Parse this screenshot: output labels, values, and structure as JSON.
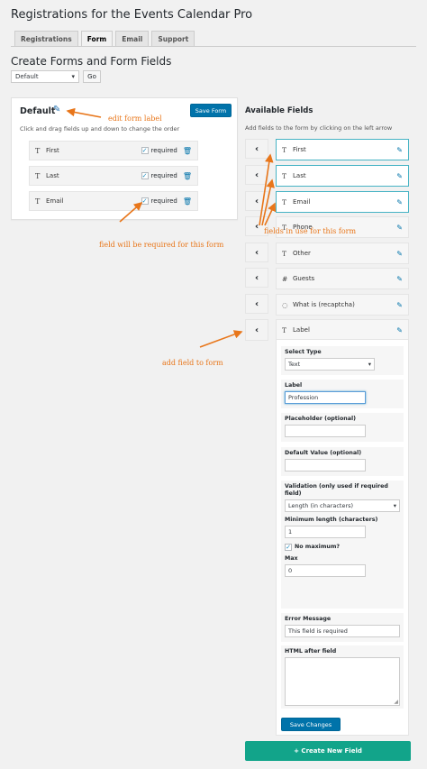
{
  "page_title": "Registrations for the Events Calendar Pro",
  "tabs": [
    "Registrations",
    "Form",
    "Email",
    "Support"
  ],
  "section_title": "Create Forms and Form Fields",
  "form_select": {
    "value": "Default",
    "go_label": "Go"
  },
  "form_box": {
    "label": "Default",
    "save_label": "Save Form",
    "hint": "Click and drag fields up and down to change the order",
    "fields": [
      {
        "name": "First",
        "required_label": "required"
      },
      {
        "name": "Last",
        "required_label": "required"
      },
      {
        "name": "Email",
        "required_label": "required"
      }
    ]
  },
  "available": {
    "title": "Available Fields",
    "hint": "Add fields to the form by clicking on the left arrow",
    "fields": [
      {
        "name": "First",
        "icon": "T"
      },
      {
        "name": "Last",
        "icon": "T"
      },
      {
        "name": "Email",
        "icon": "T"
      },
      {
        "name": "Phone",
        "icon": "T"
      },
      {
        "name": "Other",
        "icon": "T"
      },
      {
        "name": "Guests",
        "icon": "#"
      },
      {
        "name": "What is (recaptcha)",
        "icon": "◌"
      },
      {
        "name": "Label",
        "icon": "T"
      }
    ]
  },
  "settings": {
    "select_type_label": "Select Type",
    "select_type_value": "Text",
    "label_label": "Label",
    "label_value": "Profession",
    "placeholder_label": "Placeholder (optional)",
    "default_label": "Default Value (optional)",
    "validation_label": "Validation (only used if required field)",
    "validation_value": "Length (in characters)",
    "min_label": "Minimum length (characters)",
    "min_value": "1",
    "no_max_label": "No maximum?",
    "max_label": "Max",
    "max_value": "0",
    "error_label": "Error Message",
    "error_value": "This field is required",
    "html_after_label": "HTML after field",
    "save_changes": "Save Changes"
  },
  "create_new_field": "+ Create New Field",
  "annotations": {
    "edit_label": "edit form label",
    "in_use": "fields in use for this form",
    "required": "field will be required for this form",
    "add_field": "add field to form"
  },
  "colors": {
    "accent": "#0073aa",
    "annotation": "#e8761a",
    "create_button": "#12a48a"
  }
}
